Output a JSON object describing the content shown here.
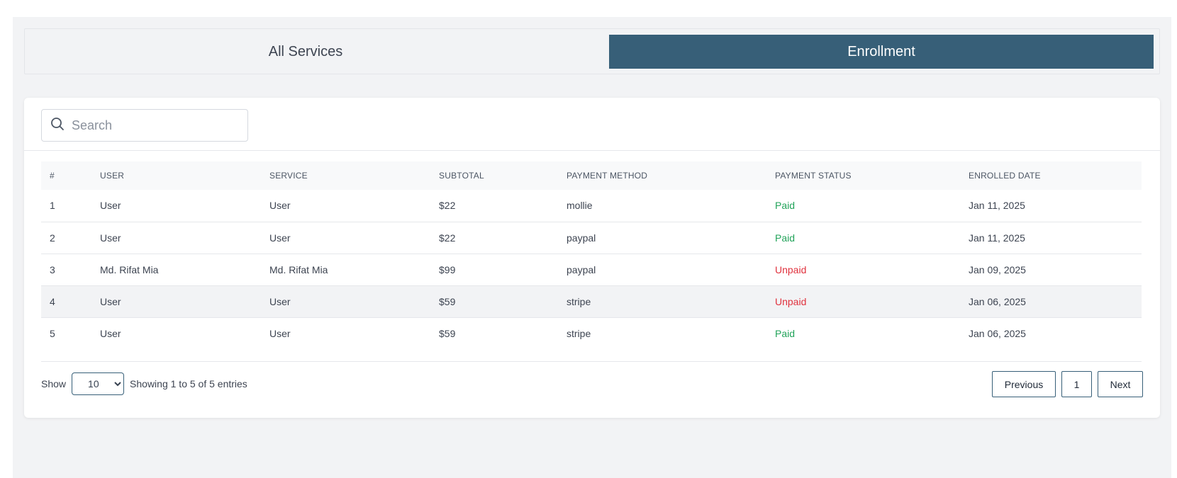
{
  "tabs": [
    {
      "label": "All Services",
      "active": false
    },
    {
      "label": "Enrollment",
      "active": true
    }
  ],
  "search": {
    "placeholder": "Search",
    "value": ""
  },
  "table": {
    "headers": [
      "#",
      "USER",
      "SERVICE",
      "SUBTOTAL",
      "PAYMENT METHOD",
      "PAYMENT STATUS",
      "ENROLLED DATE"
    ],
    "rows": [
      {
        "num": "1",
        "user": "User",
        "service": "User",
        "subtotal": "$22",
        "method": "mollie",
        "status": "Paid",
        "date": "Jan 11, 2025"
      },
      {
        "num": "2",
        "user": "User",
        "service": "User",
        "subtotal": "$22",
        "method": "paypal",
        "status": "Paid",
        "date": "Jan 11, 2025"
      },
      {
        "num": "3",
        "user": "Md. Rifat Mia",
        "service": "Md. Rifat Mia",
        "subtotal": "$99",
        "method": "paypal",
        "status": "Unpaid",
        "date": "Jan 09, 2025"
      },
      {
        "num": "4",
        "user": "User",
        "service": "User",
        "subtotal": "$59",
        "method": "stripe",
        "status": "Unpaid",
        "date": "Jan 06, 2025"
      },
      {
        "num": "5",
        "user": "User",
        "service": "User",
        "subtotal": "$59",
        "method": "stripe",
        "status": "Paid",
        "date": "Jan 06, 2025"
      }
    ]
  },
  "footer": {
    "show_label": "Show",
    "page_size": "10",
    "page_size_options": [
      "10"
    ],
    "entries_text": "Showing 1 to 5 of 5 entries",
    "previous_label": "Previous",
    "current_page": "1",
    "next_label": "Next"
  },
  "colors": {
    "accent": "#375f78",
    "paid": "#22a35a",
    "unpaid": "#e0313d"
  },
  "icons": {
    "search": "search-icon"
  }
}
